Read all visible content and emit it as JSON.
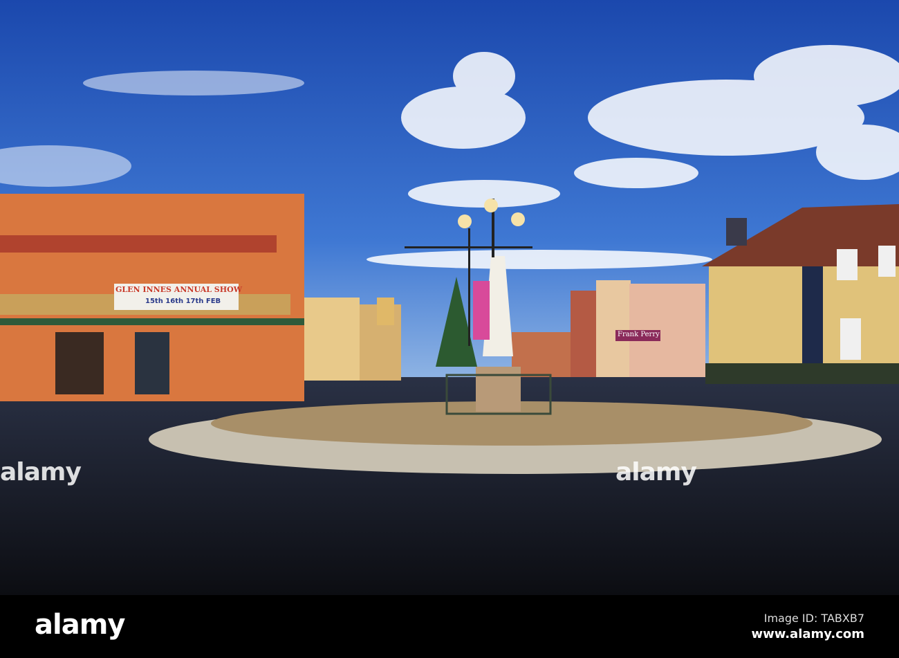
{
  "photo": {
    "banner_title": "GLEN INNES ANNUAL SHOW",
    "banner_dates": "15th 16th 17th FEB",
    "shop_sign": "Frank Perry",
    "watermark_left": "alamy",
    "watermark_right": "alamy"
  },
  "footer": {
    "logo": "alamy",
    "image_id": "Image ID: TABXB7",
    "url": "www.alamy.com"
  },
  "colors": {
    "sky_top": "#1d4fb5",
    "sky_bottom": "#7aa6e0",
    "road": "#12141c",
    "building_left": "#d9773f",
    "building_right": "#e0c27a"
  }
}
